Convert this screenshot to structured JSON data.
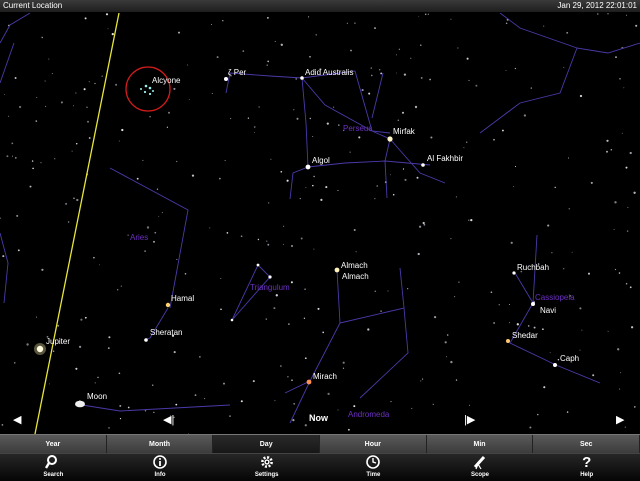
{
  "status_bar": {
    "location": "Current Location",
    "datetime": "Jan 29, 2012  22:01:01"
  },
  "stars": {
    "alcyone": "Alcyone",
    "zeta_per": "ζ Per",
    "adid_australis": "Adid Australis",
    "mirfak": "Mirfak",
    "algol": "Algol",
    "al_fakhbir": "Al Fakhbir",
    "almach_1": "Almach",
    "almach_2": "Almach",
    "hamal": "Hamal",
    "sheratan": "Sheratan",
    "ruchbah": "Ruchbah",
    "navi": "Navi",
    "shedar": "Shedar",
    "caph": "Caph",
    "mirach": "Mirach"
  },
  "planets": {
    "jupiter": "Jupiter",
    "moon": "Moon"
  },
  "constellations": {
    "perseus": "Perseus",
    "aries": "Aries",
    "triangulum": "Triangulum",
    "cassiopeia": "Cassiopeia",
    "andromeda": "Andromeda"
  },
  "nav": {
    "now": "Now",
    "prev": "◀",
    "step_back": "◀|",
    "step_fwd": "|▶",
    "next": "▶"
  },
  "time_tabs": [
    "Year",
    "Month",
    "Day",
    "Hour",
    "Min",
    "Sec"
  ],
  "active_tab": "Day",
  "toolbar": {
    "search": "Search",
    "info": "Info",
    "settings": "Settings",
    "time": "Time",
    "scope": "Scope",
    "help": "Help"
  },
  "colors": {
    "constellation_line": "#4a3aa8",
    "constellation_label": "#6b2fc0",
    "ecliptic": "#e6e63a",
    "selection_ring": "#d41c1c"
  }
}
